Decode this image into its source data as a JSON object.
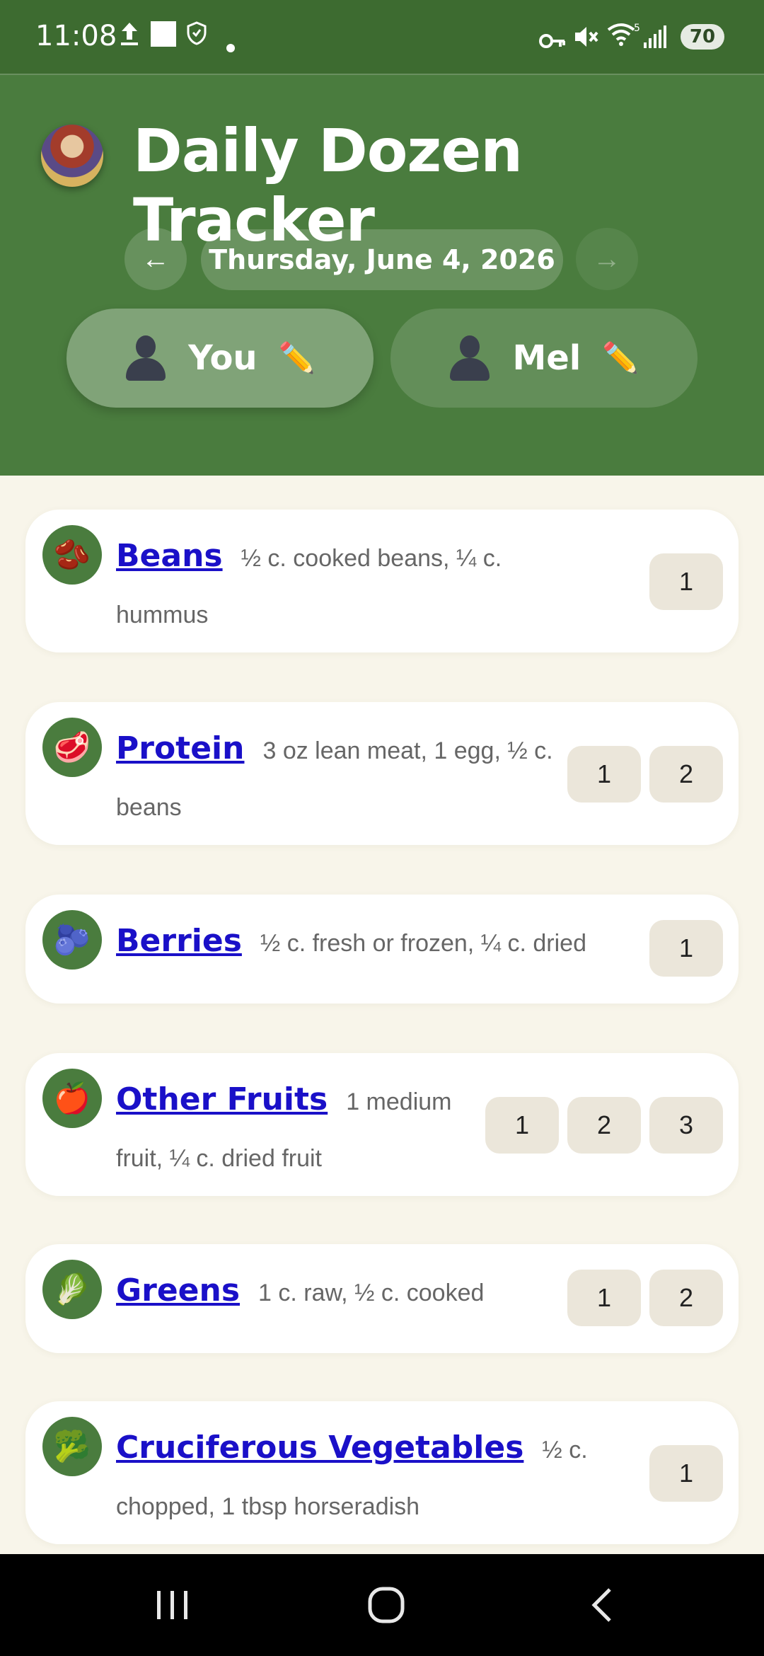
{
  "status_bar": {
    "time": "11:08",
    "battery": "70",
    "left_icons": [
      "upload-icon",
      "square-icon",
      "shield-icon",
      "dot-icon"
    ],
    "right_icons": [
      "key-icon",
      "mute-icon",
      "wifi-icon",
      "signal-icon"
    ]
  },
  "header": {
    "title": "Daily Dozen Tracker",
    "date": "Thursday, June 4, 2026",
    "prev_label": "←",
    "next_label": "→",
    "people": [
      {
        "name": "You",
        "edit": "✏️",
        "active": true
      },
      {
        "name": "Mel",
        "edit": "✏️",
        "active": false
      }
    ]
  },
  "items": [
    {
      "name": "Beans",
      "desc": "½ c. cooked beans, ¼ c. hummus",
      "icon": "🫘",
      "icon_name": "beans-icon",
      "servings": [
        "1"
      ]
    },
    {
      "name": "Protein",
      "desc": "3 oz lean meat, 1 egg, ½ c. beans",
      "icon": "🥩",
      "icon_name": "meat-icon",
      "servings": [
        "1",
        "2"
      ]
    },
    {
      "name": "Berries",
      "desc": "½ c. fresh or frozen, ¼ c. dried",
      "icon": "🫐",
      "icon_name": "blueberries-icon",
      "servings": [
        "1"
      ]
    },
    {
      "name": "Other Fruits",
      "desc": "1 medium fruit, ¼ c. dried fruit",
      "icon": "🍎",
      "icon_name": "apple-icon",
      "servings": [
        "1",
        "2",
        "3"
      ]
    },
    {
      "name": "Greens",
      "desc": "1 c. raw, ½ c. cooked",
      "icon": "🥬",
      "icon_name": "leafy-greens-icon",
      "servings": [
        "1",
        "2"
      ]
    },
    {
      "name": "Cruciferous Vegetables",
      "desc": "½ c. chopped, 1 tbsp horseradish",
      "icon": "🥦",
      "icon_name": "broccoli-icon",
      "servings": [
        "1"
      ]
    }
  ],
  "colors": {
    "header_green": "#4a7c3e",
    "status_green": "#3d6b30",
    "link_blue": "#1a10c8",
    "page_bg": "#f8f5ea",
    "serving_bg": "#ebe6da"
  }
}
